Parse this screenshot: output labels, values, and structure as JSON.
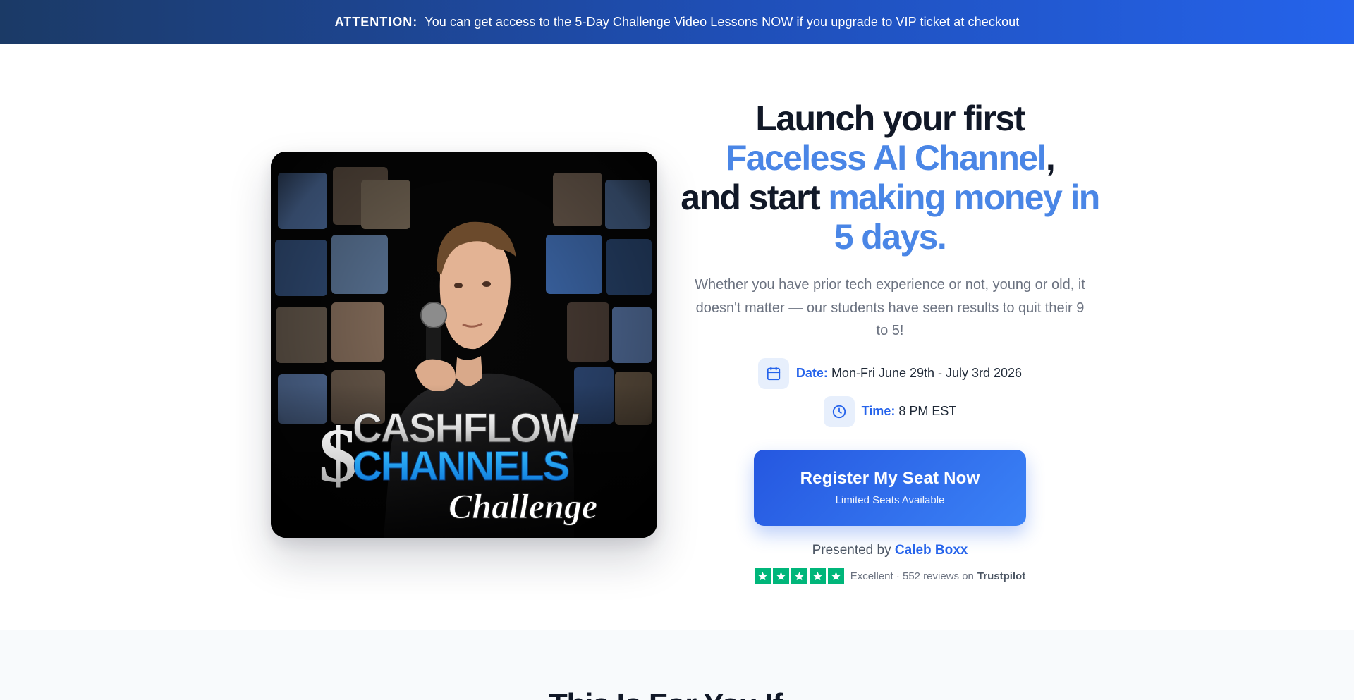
{
  "banner": {
    "label": "ATTENTION:",
    "text": "You can get access to the 5-Day Challenge Video Lessons NOW if you upgrade to VIP ticket at checkout"
  },
  "hero_image": {
    "title_line1": "CASHFLOW",
    "title_line2": "CHANNELS",
    "title_line3": "Challenge",
    "symbol": "$"
  },
  "headline": {
    "part1": "Launch your first",
    "highlight1": "Faceless AI Channel",
    "comma": ",",
    "part2": "and start",
    "highlight2": "making money in 5 days."
  },
  "subtext": "Whether you have prior tech experience or not, young or old, it doesn't matter — our students have seen results to quit their 9 to 5!",
  "event": {
    "date_label": "Date:",
    "date_value": "Mon-Fri June 29th - July 3rd 2026",
    "time_label": "Time:",
    "time_value": "8 PM EST",
    "date_icon": "calendar-icon",
    "time_icon": "clock-icon"
  },
  "cta": {
    "label": "Register My Seat Now",
    "sublabel": "Limited Seats Available"
  },
  "presenter": {
    "prefix": "Presented by",
    "name": "Caleb Boxx"
  },
  "reviews": {
    "rating_word": "Excellent",
    "separator": "·",
    "count_text": "552 reviews on",
    "platform": "Trustpilot",
    "stars": 5,
    "star_color": "#00b67a"
  },
  "next_section": {
    "heading": "This Is For You If..."
  },
  "colors": {
    "accent": "#2563eb",
    "headline_highlight": "#4a86e6",
    "banner_start": "#1b3a66",
    "banner_end": "#2563eb"
  }
}
